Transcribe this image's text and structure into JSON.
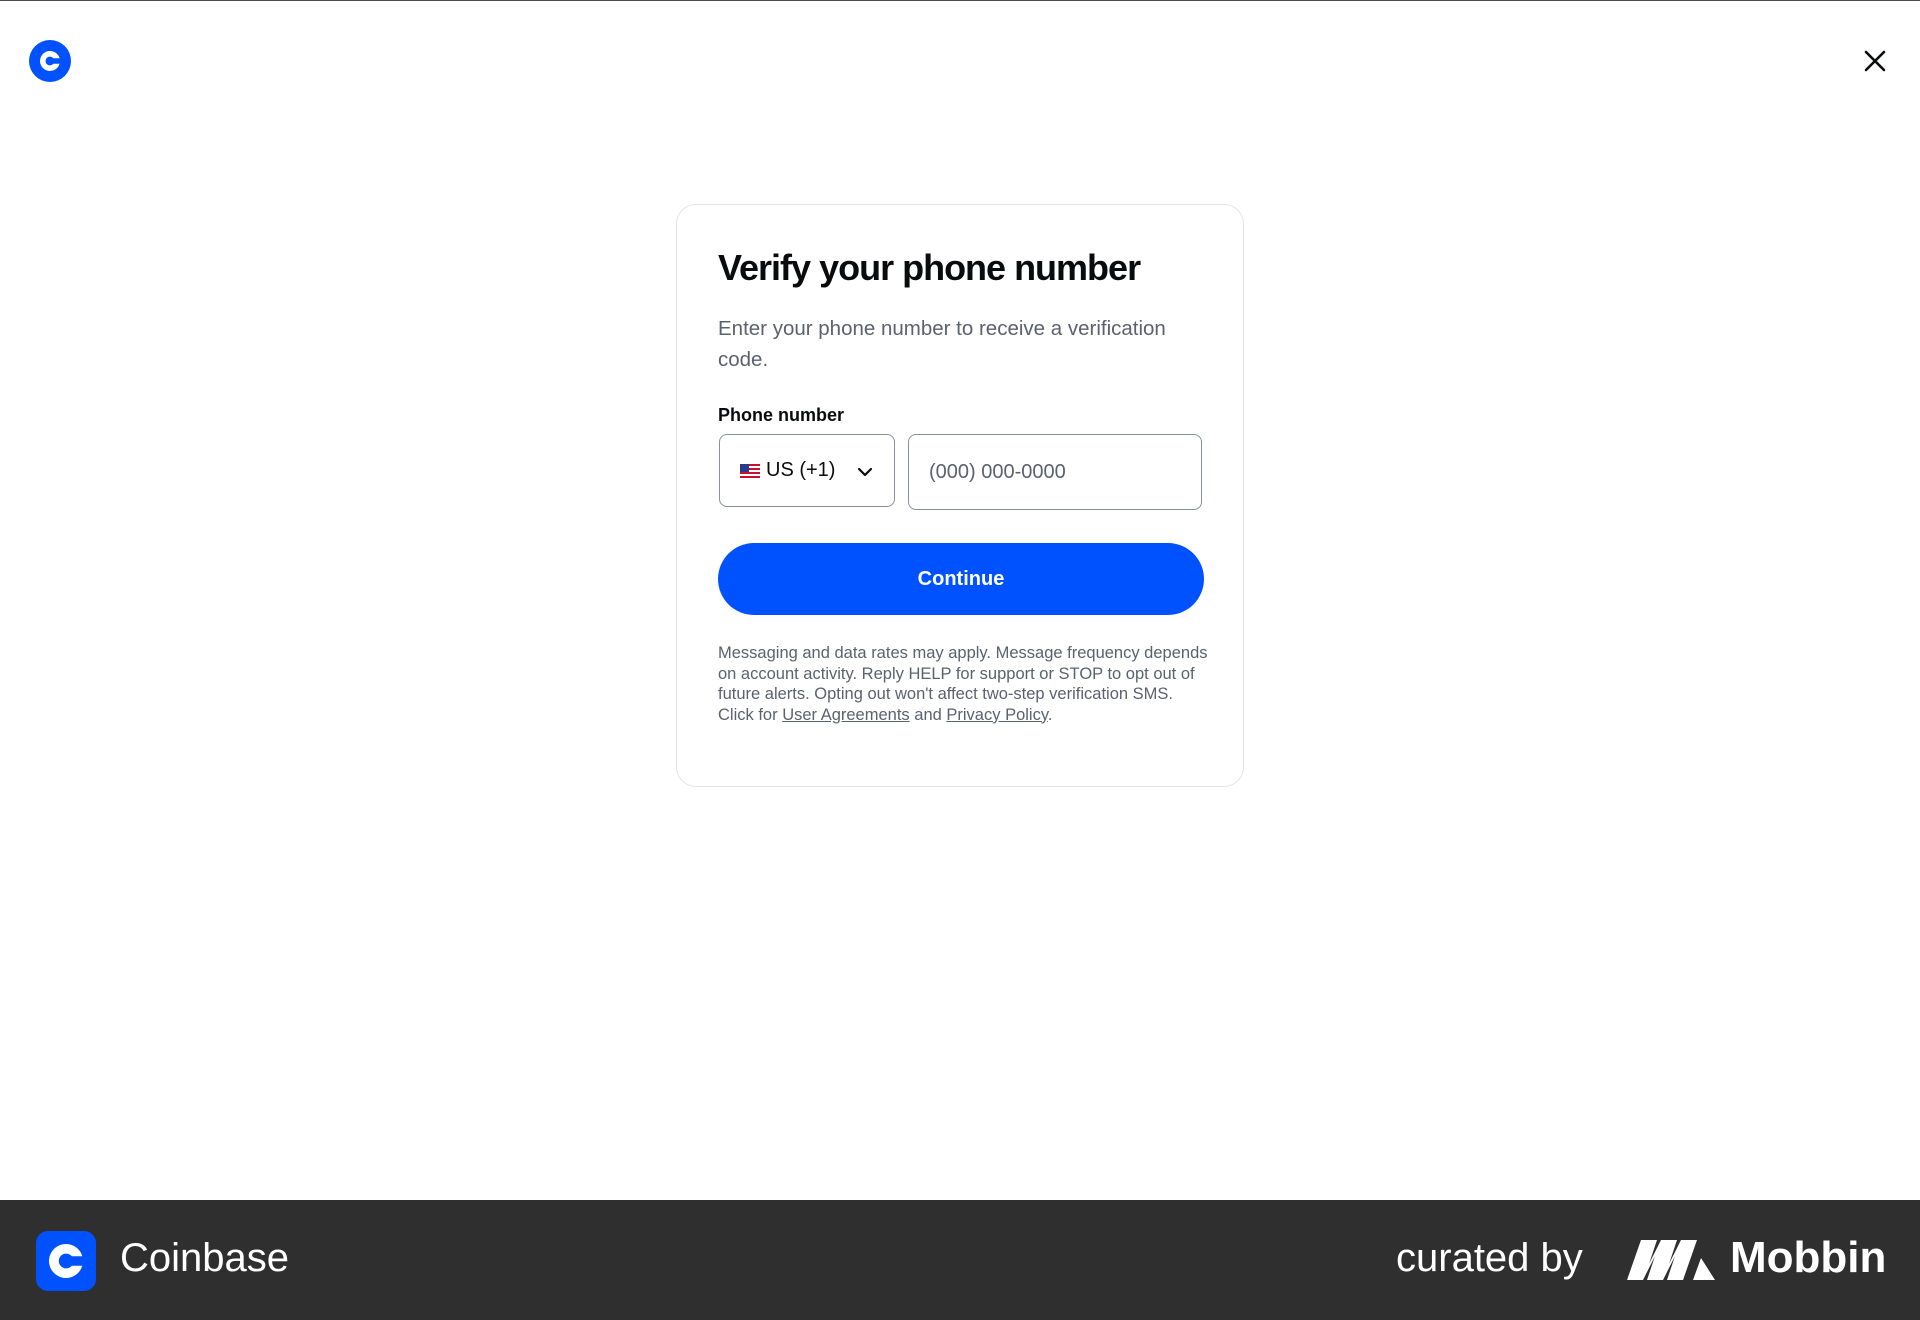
{
  "brand": {
    "accent": "#0052ff"
  },
  "card": {
    "title": "Verify your phone number",
    "subtitle": "Enter your phone number to receive a verification code.",
    "phone_label": "Phone number",
    "country_select": {
      "value": "US (+1)",
      "flag": "us-flag-icon"
    },
    "phone_input": {
      "value": "",
      "placeholder": "(000) 000-0000"
    },
    "continue_label": "Continue",
    "disclaimer": {
      "text": "Messaging and data rates may apply. Message frequency depends on account activity. Reply HELP for support or STOP to opt out of future alerts. Opting out won't affect two-step verification SMS. Click for",
      "link1": "User Agreements",
      "and": "and",
      "link2": "Privacy Policy",
      "end": "."
    }
  },
  "footer": {
    "brand_name": "Coinbase",
    "curated_by": "curated by",
    "mobbin": "Mobbin"
  }
}
